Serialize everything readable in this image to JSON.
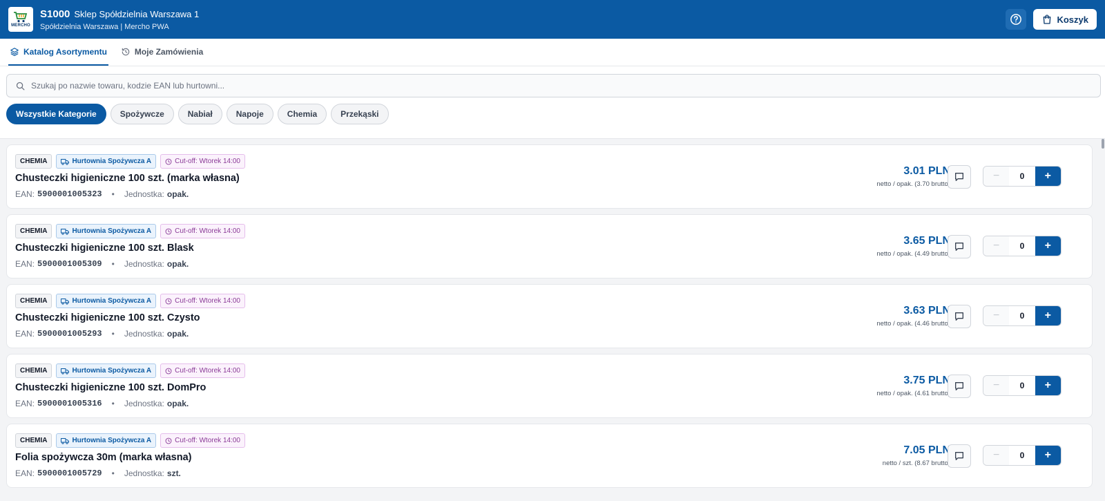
{
  "header": {
    "store_code": "S1000",
    "store_name": "Sklep Spółdzielnia Warszawa 1",
    "subtitle": "Spółdzielnia Warszawa | Mercho PWA",
    "logo_text": "MERCHO",
    "cart_label": "Koszyk",
    "help_icon": "help-circle-icon",
    "cart_icon": "shopping-bag-icon",
    "brand_color": "#0b5aa3"
  },
  "tabs": [
    {
      "label": "Katalog Asortymentu",
      "icon": "layers-icon",
      "active": true
    },
    {
      "label": "Moje Zamówienia",
      "icon": "history-icon",
      "active": false
    }
  ],
  "search": {
    "placeholder": "Szukaj po nazwie towaru, kodzie EAN lub hurtowni...",
    "value": ""
  },
  "categories": [
    {
      "label": "Wszystkie Kategorie",
      "active": true
    },
    {
      "label": "Spożywcze",
      "active": false
    },
    {
      "label": "Nabiał",
      "active": false
    },
    {
      "label": "Napoje",
      "active": false
    },
    {
      "label": "Chemia",
      "active": false
    },
    {
      "label": "Przekąski",
      "active": false
    }
  ],
  "labels": {
    "ean": "EAN:",
    "unit": "Jednostka:",
    "bullet": "•"
  },
  "products": [
    {
      "category": "CHEMIA",
      "wholesaler": "Hurtownia Spożywcza A",
      "cutoff": "Cut-off: Wtorek 14:00",
      "name": "Chusteczki higieniczne 100 szt. (marka własna)",
      "ean": "5900001005323",
      "unit": "opak.",
      "price": "3.01 PLN",
      "price_note": "netto / opak. (3.70 brutto)",
      "qty": "0"
    },
    {
      "category": "CHEMIA",
      "wholesaler": "Hurtownia Spożywcza A",
      "cutoff": "Cut-off: Wtorek 14:00",
      "name": "Chusteczki higieniczne 100 szt. Blask",
      "ean": "5900001005309",
      "unit": "opak.",
      "price": "3.65 PLN",
      "price_note": "netto / opak. (4.49 brutto)",
      "qty": "0"
    },
    {
      "category": "CHEMIA",
      "wholesaler": "Hurtownia Spożywcza A",
      "cutoff": "Cut-off: Wtorek 14:00",
      "name": "Chusteczki higieniczne 100 szt. Czysto",
      "ean": "5900001005293",
      "unit": "opak.",
      "price": "3.63 PLN",
      "price_note": "netto / opak. (4.46 brutto)",
      "qty": "0"
    },
    {
      "category": "CHEMIA",
      "wholesaler": "Hurtownia Spożywcza A",
      "cutoff": "Cut-off: Wtorek 14:00",
      "name": "Chusteczki higieniczne 100 szt. DomPro",
      "ean": "5900001005316",
      "unit": "opak.",
      "price": "3.75 PLN",
      "price_note": "netto / opak. (4.61 brutto)",
      "qty": "0"
    },
    {
      "category": "CHEMIA",
      "wholesaler": "Hurtownia Spożywcza A",
      "cutoff": "Cut-off: Wtorek 14:00",
      "name": "Folia spożywcza 30m (marka własna)",
      "ean": "5900001005729",
      "unit": "szt.",
      "price": "7.05 PLN",
      "price_note": "netto / szt. (8.67 brutto)",
      "qty": "0"
    }
  ]
}
